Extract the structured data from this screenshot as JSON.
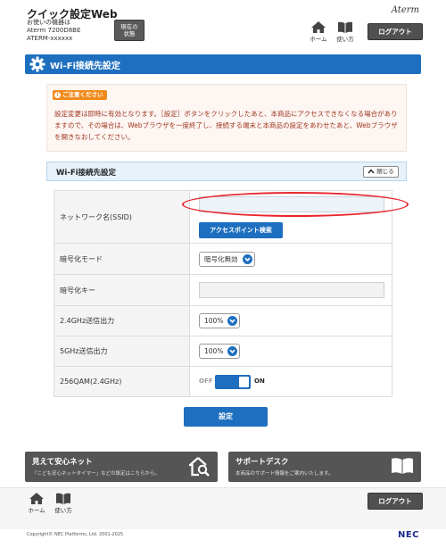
{
  "header": {
    "title": "クイック設定Web",
    "device_line1": "お使いの機器は",
    "device_line2": "Aterm 7200D8BE",
    "device_line3": "ATERM-xxxxxx",
    "status_line1": "現在の",
    "status_line2": "状態",
    "brand": "Aterm",
    "nav_home": "ホーム",
    "nav_help": "使い方",
    "logout": "ログアウト"
  },
  "page": {
    "title": "Wi-Fi接続先設定"
  },
  "notice": {
    "badge": "ご注意ください",
    "text": "設定変更は即時に有効となります。［設定］ボタンをクリックしたあと、本商品にアクセスできなくなる場合がありますので、その場合は、Webブラウザを一度終了し、接続する端末と本商品の設定をあわせたあと、Webブラウザを開きなおしてください。"
  },
  "section": {
    "title": "Wi-Fi接続先設定",
    "collapse": "閉じる"
  },
  "form": {
    "ssid_label": "ネットワーク名(SSID)",
    "ssid_value": "",
    "ap_search": "アクセスポイント検索",
    "enc_mode_label": "暗号化モード",
    "enc_mode_value": "暗号化無効",
    "enc_key_label": "暗号化キー",
    "enc_key_value": "",
    "power24_label": "2.4GHz送信出力",
    "power24_value": "100%",
    "power5_label": "5GHz送信出力",
    "power5_value": "100%",
    "qam_label": "256QAM(2.4GHz)",
    "qam_off": "OFF",
    "qam_on": "ON",
    "submit": "設定"
  },
  "banners": {
    "left_title": "見えて安心ネット",
    "left_desc": "「こども安心ネットタイマー」などの設定はこちらから。",
    "right_title": "サポートデスク",
    "right_desc": "本商品のサポート情報をご案内いたします。"
  },
  "footer": {
    "nav_home": "ホーム",
    "nav_help": "使い方",
    "logout": "ログアウト",
    "copyright": "Copyright© NEC Platforms, Ltd. 2001-2025",
    "brand": "NEC"
  },
  "colors": {
    "accent": "#1e6fbf",
    "notice_text": "#a0371f",
    "badge": "#f08a1c",
    "highlight": "#e8272d"
  }
}
